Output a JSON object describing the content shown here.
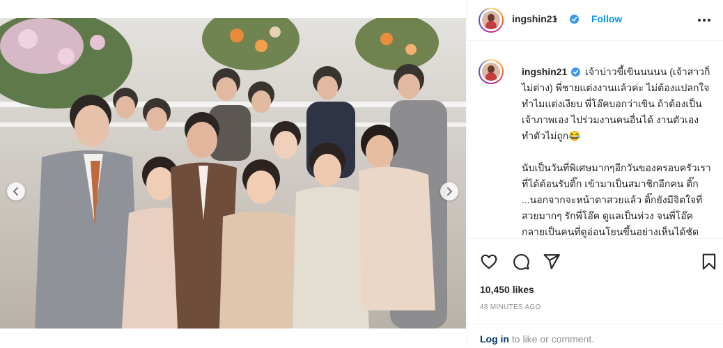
{
  "post": {
    "username": "ingshin21",
    "follow_label": "Follow",
    "bullet": "•",
    "caption_para1": "เจ้าบ่าวขี้เขินนนนน (เจ้าสาวก็ไม่ต่าง) พี่ชายแต่งงานแล้วค่ะ ไม่ต้องแปลกใจ ทำไมแต่งเงียบ พี่โอ๊คบอกว่าเขิน ถ้าต้องเป็นเจ้าภาพเอง ไปร่วมงานคนอื่นได้ งานตัวเองทำตัวไม่ถูก😂",
    "caption_para2": "นับเป็นวันที่พิเศษมากๆอีกวันของครอบครัวเรา ที่ได้ต้อนรับติ๊ก เข้ามาเป็นสมาชิกอีกคน ติ๊ก ...นอกจากจะหน้าตาสวยแล้ว ติ๊กยังมีจิตใจที่สวยมากๆ รักพี่โอ๊ค ดูแลเป็นห่วง จนพี่โอ๊ค กลายเป็นคนที่ดูอ่อนโยนขึ้นอย่างเห็นได้ชัด 😍 ขอบคุณติ๊กที่รักพี่โอ๊คในแบบที่พี่โอ๊คเป็น และเป็นคนที่ทำให้ครอบครัวเรามีความสุข ❤️",
    "likes": "10,450 likes",
    "time": "48 MINUTES AGO",
    "login_label": "Log in",
    "login_suffix": " to like or comment."
  },
  "carousel": {
    "slide_count": 6,
    "active_slide": 5
  },
  "icons": {
    "prev": "chevron-left-icon",
    "next": "chevron-right-icon",
    "more": "more-options-icon",
    "like": "heart-icon",
    "comment": "comment-icon",
    "share": "share-icon",
    "save": "bookmark-icon",
    "verified": "verified-badge-icon"
  },
  "colors": {
    "link": "#0095f6",
    "verified": "#3897f0",
    "text": "#262626",
    "muted": "#8e8e8e"
  }
}
